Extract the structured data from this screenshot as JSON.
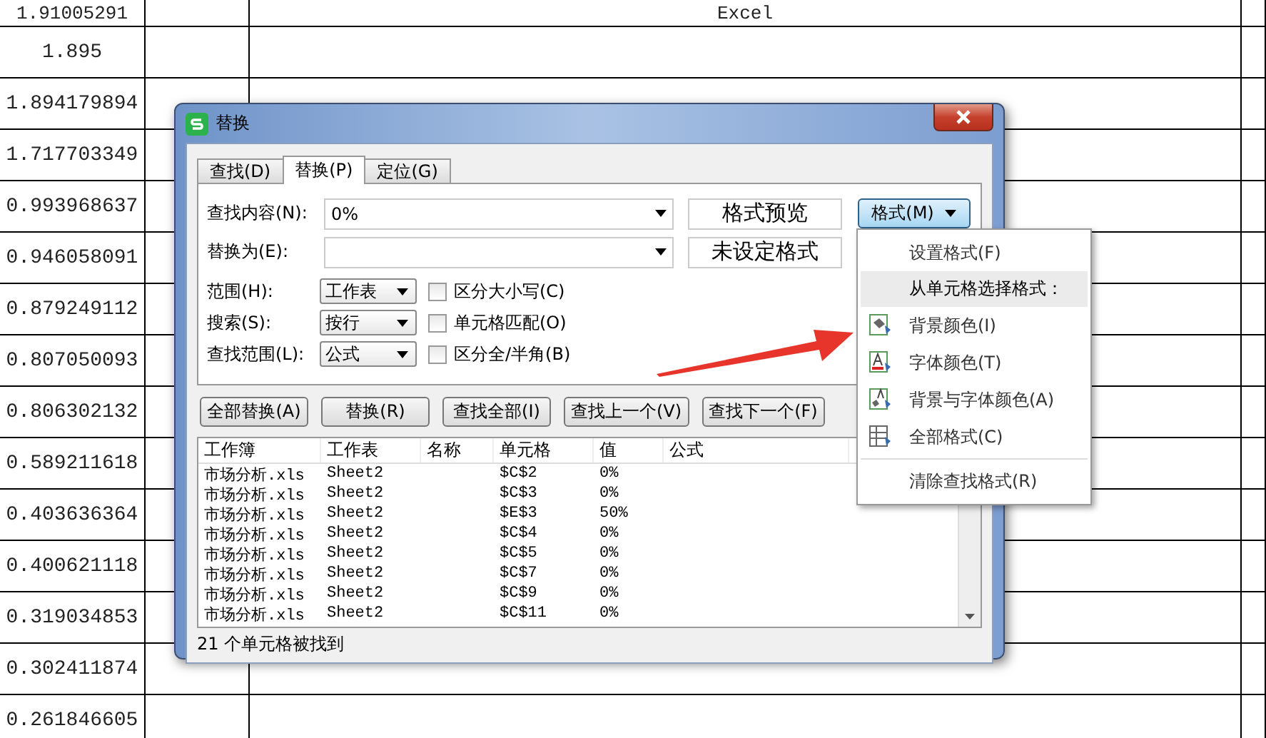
{
  "sheet": {
    "rows": [
      {
        "column_1": "1.91005291",
        "column_3": "Excel"
      },
      {
        "column_1": "1.895"
      },
      {
        "column_1": "1.894179894"
      },
      {
        "column_1": "1.717703349"
      },
      {
        "column_1": "0.993968637"
      },
      {
        "column_1": "0.946058091"
      },
      {
        "column_1": "0.879249112"
      },
      {
        "column_1": "0.807050093"
      },
      {
        "column_1": "0.806302132"
      },
      {
        "column_1": "0.589211618"
      },
      {
        "column_1": "0.403636364"
      },
      {
        "column_1": "0.400621118"
      },
      {
        "column_1": "0.319034853"
      },
      {
        "column_1": "0.302411874"
      },
      {
        "column_1": "0.261846605"
      }
    ]
  },
  "dialog": {
    "title": "替换",
    "tabs": [
      {
        "label": "查找(D)",
        "selected": false
      },
      {
        "label": "替换(P)",
        "selected": true
      },
      {
        "label": "定位(G)",
        "selected": false
      }
    ],
    "find": {
      "label": "查找内容(N):",
      "value": "0%"
    },
    "replace": {
      "label": "替换为(E):"
    },
    "format_preview": "格式预览",
    "format_status": "未设定格式",
    "format_button": {
      "label": "格式(M)",
      "expanded": true
    },
    "options": [
      {
        "label": "范围(H):",
        "select": "工作表",
        "checkbox": "区分大小写(C)",
        "checked": false
      },
      {
        "label": "搜索(S):",
        "select": "按行",
        "checkbox": "单元格匹配(O)",
        "checked": false
      },
      {
        "label": "查找范围(L):",
        "select": "公式",
        "checkbox": "区分全/半角(B)",
        "checked": false
      }
    ],
    "buttons": [
      "全部替换(A)",
      "替换(R)",
      "查找全部(I)",
      "查找上一个(V)",
      "查找下一个(F)"
    ],
    "results": {
      "columns": [
        "工作簿",
        "工作表",
        "名称",
        "单元格",
        "值",
        "公式"
      ],
      "rows": [
        [
          "市场分析.xls",
          "Sheet2",
          "",
          "$C$2",
          "0%",
          ""
        ],
        [
          "市场分析.xls",
          "Sheet2",
          "",
          "$C$3",
          "0%",
          ""
        ],
        [
          "市场分析.xls",
          "Sheet2",
          "",
          "$E$3",
          "50%",
          ""
        ],
        [
          "市场分析.xls",
          "Sheet2",
          "",
          "$C$4",
          "0%",
          ""
        ],
        [
          "市场分析.xls",
          "Sheet2",
          "",
          "$C$5",
          "0%",
          ""
        ],
        [
          "市场分析.xls",
          "Sheet2",
          "",
          "$C$7",
          "0%",
          ""
        ],
        [
          "市场分析.xls",
          "Sheet2",
          "",
          "$C$9",
          "0%",
          ""
        ],
        [
          "市场分析.xls",
          "Sheet2",
          "",
          "$C$11",
          "0%",
          ""
        ]
      ]
    },
    "status": "21 个单元格被找到"
  },
  "format_menu": {
    "items": [
      {
        "kind": "plain",
        "label": "设置格式(F)"
      },
      {
        "kind": "header",
        "label": "从单元格选择格式："
      },
      {
        "kind": "icon",
        "label": "背景颜色(I)"
      },
      {
        "kind": "icon",
        "label": "字体颜色(T)"
      },
      {
        "kind": "icon",
        "label": "背景与字体颜色(A)"
      },
      {
        "kind": "icon",
        "label": "全部格式(C)"
      },
      {
        "kind": "separator"
      },
      {
        "kind": "plain",
        "label": "清除查找格式(R)"
      }
    ]
  }
}
